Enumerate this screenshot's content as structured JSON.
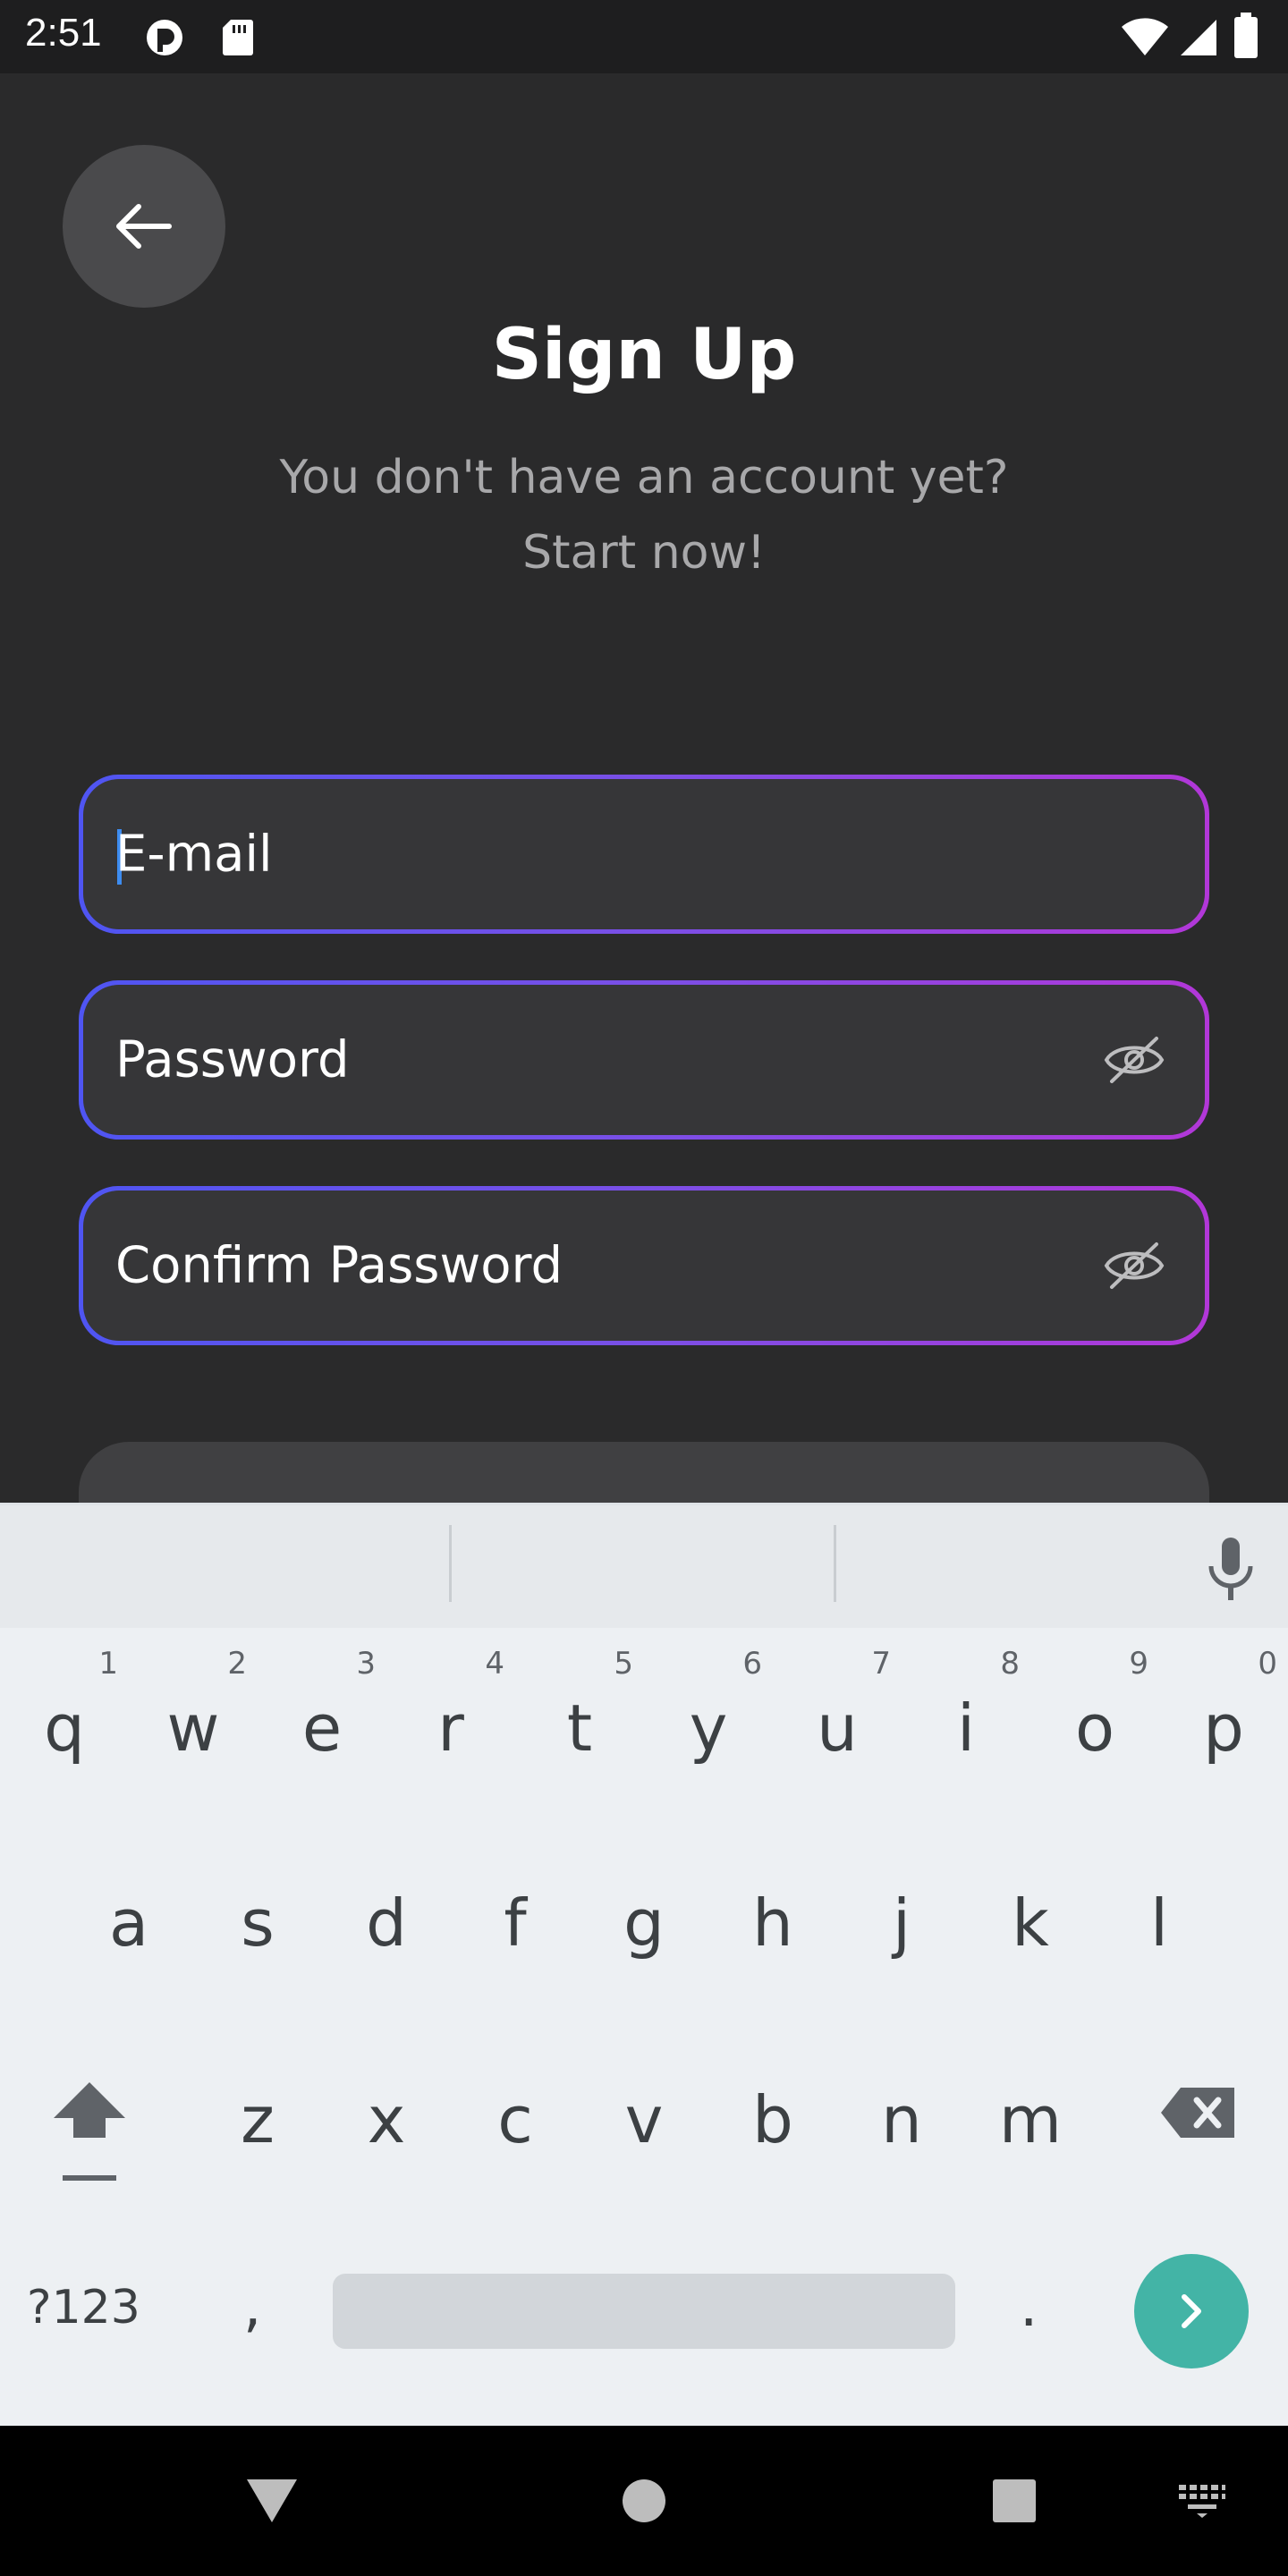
{
  "status_bar": {
    "time": "2:51",
    "icons": [
      "notification-app-icon",
      "sd-card-icon",
      "wifi-icon",
      "signal-icon",
      "battery-icon"
    ]
  },
  "header": {
    "back_icon": "arrow-left-icon",
    "title": "Sign Up",
    "subtitle_line1": "You don't have an account yet?",
    "subtitle_line2": "Start now!"
  },
  "form": {
    "email_placeholder": "E-mail",
    "password_placeholder": "Password",
    "confirm_password_placeholder": "Confirm Password",
    "visibility_icon": "eye-off-icon"
  },
  "colors": {
    "background": "#2a2a2b",
    "field_gradient_start": "#4f55f2",
    "field_gradient_end": "#b237d8",
    "keyboard_accent": "#43b4a6"
  },
  "keyboard": {
    "row1": [
      {
        "k": "q",
        "h": "1"
      },
      {
        "k": "w",
        "h": "2"
      },
      {
        "k": "e",
        "h": "3"
      },
      {
        "k": "r",
        "h": "4"
      },
      {
        "k": "t",
        "h": "5"
      },
      {
        "k": "y",
        "h": "6"
      },
      {
        "k": "u",
        "h": "7"
      },
      {
        "k": "i",
        "h": "8"
      },
      {
        "k": "o",
        "h": "9"
      },
      {
        "k": "p",
        "h": "0"
      }
    ],
    "row2": [
      "a",
      "s",
      "d",
      "f",
      "g",
      "h",
      "j",
      "k",
      "l"
    ],
    "row3": [
      "z",
      "x",
      "c",
      "v",
      "b",
      "n",
      "m"
    ],
    "symbols_label": "?123",
    "comma": ",",
    "period": ".",
    "shift_icon": "shift-icon",
    "backspace_icon": "backspace-icon",
    "go_icon": "chevron-right-icon",
    "mic_icon": "mic-icon"
  },
  "nav_bar": {
    "icons": [
      "back-triangle-icon",
      "home-circle-icon",
      "recents-square-icon",
      "keyboard-switch-icon"
    ]
  }
}
